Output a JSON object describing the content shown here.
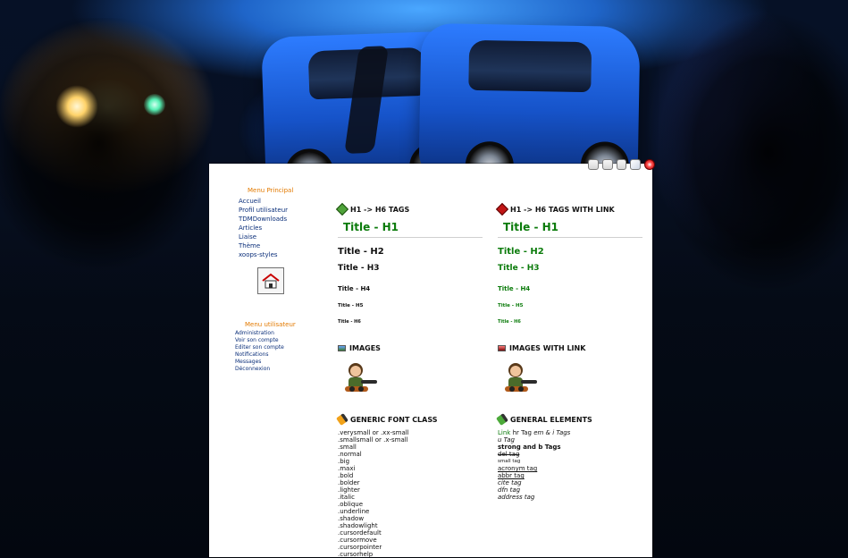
{
  "left_menu": {
    "main_title": "Menu Principal",
    "main_items": [
      "Accueil",
      "Profil utilisateur",
      "TDMDownloads",
      "Articles",
      "Liaise",
      "Thème",
      "xoops-styles"
    ],
    "user_title": "Menu utilisateur",
    "user_items": [
      "Administration",
      "Voir son compte",
      "Editer son compte",
      "Notifications",
      "Messages",
      "Déconnexion"
    ]
  },
  "sections": {
    "h_tags": {
      "title": "H1 -> H6 TAGS",
      "h1": "Title - H1",
      "h2": "Title - H2",
      "h3": "Title - H3",
      "h4": "Title - H4",
      "h5": "Title - H5",
      "h6": "Title - H6"
    },
    "h_tags_link": {
      "title": "H1 -> H6 TAGS WITH LINK",
      "h1": "Title - H1",
      "h2": "Title - H2",
      "h3": "Title - H3",
      "h4": "Title - H4",
      "h5": "Title - H5",
      "h6": "Title - H6"
    },
    "images": {
      "title": "IMAGES"
    },
    "images_link": {
      "title": "IMAGES WITH LINK"
    },
    "generic_font": {
      "title": "GENERIC FONT CLASS",
      "items": [
        ".verysmall or .xx-small",
        ".smallsmall or .x-small",
        ".small",
        ".normal",
        ".big",
        ".maxi",
        ".bold",
        ".bolder",
        ".lighter",
        ".italic",
        ".oblique",
        ".underline",
        ".shadow",
        ".shadowlight",
        ".cursordefault",
        ".cursormove",
        ".cursorpointer",
        ".cursorhelp"
      ]
    },
    "general_elements": {
      "title": "GENERAL ELEMENTS",
      "line1_link": "Link",
      "line1_rest": " hr Tag",
      "line1_em": " em & i Tags",
      "u_tag": "u Tag",
      "strong_tag": "strong and b Tags",
      "del_tag": "del tag",
      "small_tag": "small tag",
      "acronym_tag": "acronym tag",
      "abbr_tag": "abbr tag",
      "cite_tag": "cite tag",
      "dfn_tag": "dfn tag",
      "address_tag": "address tag"
    }
  },
  "top_icons": [
    "document-icon",
    "notes-icon",
    "folder-icon",
    "tools-icon",
    "power-icon"
  ],
  "colors": {
    "content_bg": "#ffffff",
    "menu_title": "#e37a00",
    "menu_link": "#0b2f7a",
    "green_link": "#0b7b0b"
  }
}
